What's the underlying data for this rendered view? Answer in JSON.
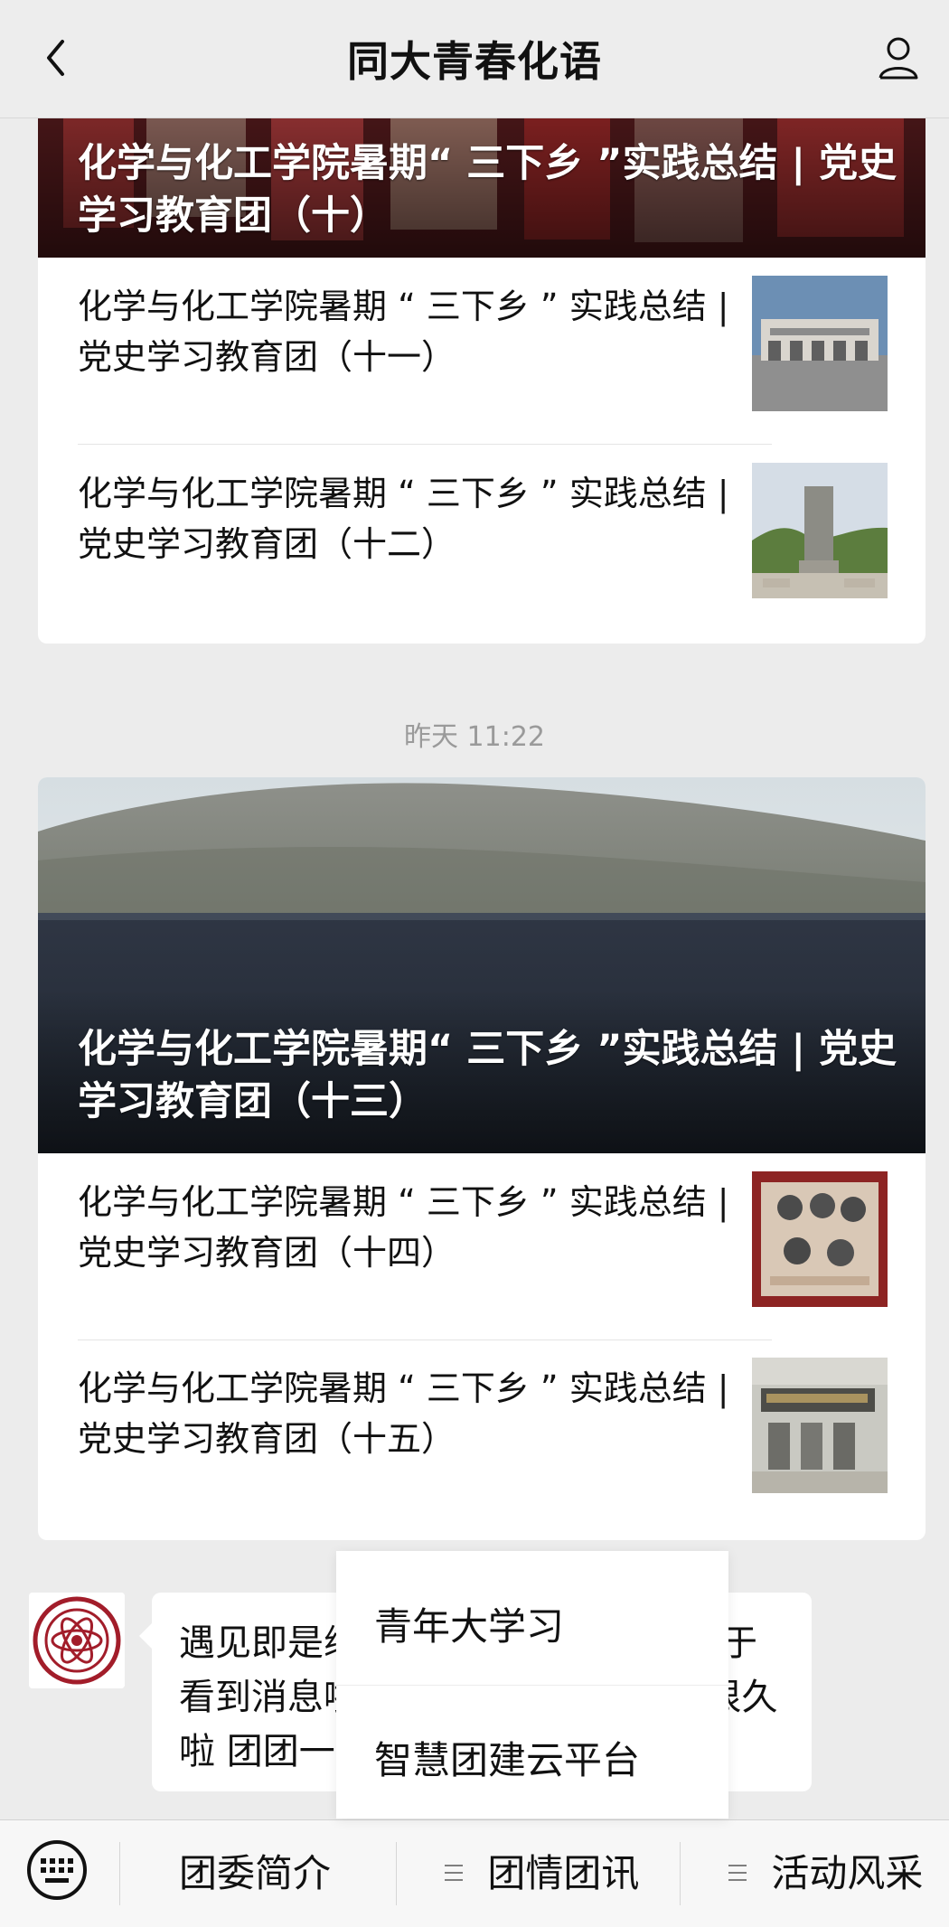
{
  "header": {
    "title": "同大青春化语"
  },
  "cards": [
    {
      "banner_title": "化学与化工学院暑期“ 三下乡 ”实践总结 | 党史学习教育团（十）",
      "articles": [
        {
          "title": "化学与化工学院暑期 “ 三下乡 ” 实践总结 | 党史学习教育团（十一）"
        },
        {
          "title": "化学与化工学院暑期 “ 三下乡 ” 实践总结 | 党史学习教育团（十二）"
        }
      ]
    },
    {
      "banner_title": "化学与化工学院暑期“ 三下乡 ”实践总结 | 党史学习教育团（十三）",
      "articles": [
        {
          "title": "化学与化工学院暑期 “ 三下乡 ” 实践总结 | 党史学习教育团（十四）"
        },
        {
          "title": "化学与化工学院暑期 “ 三下乡 ” 实践总结 | 党史学习教育团（十五）"
        }
      ]
    }
  ],
  "timestamp": "昨天 11:22",
  "chat_message": {
    "text": "遇见即是缘分，感谢关注！你们终于看到消息啦❤️ 团团在这里等你们很久啦 团团一下又何妨"
  },
  "popup_menu": {
    "items": [
      "青年大学习",
      "智慧团建云平台"
    ]
  },
  "bottom_bar": {
    "tabs": [
      "团委简介",
      "团情团讯",
      "活动风采"
    ]
  },
  "colors": {
    "background": "#ececec",
    "card": "#ffffff",
    "text": "#111111",
    "muted": "#9a9a9a",
    "accent_red": "#a21d2a"
  },
  "icons": {
    "back": "back-icon",
    "profile": "profile-icon",
    "keyboard": "keyboard-icon"
  }
}
